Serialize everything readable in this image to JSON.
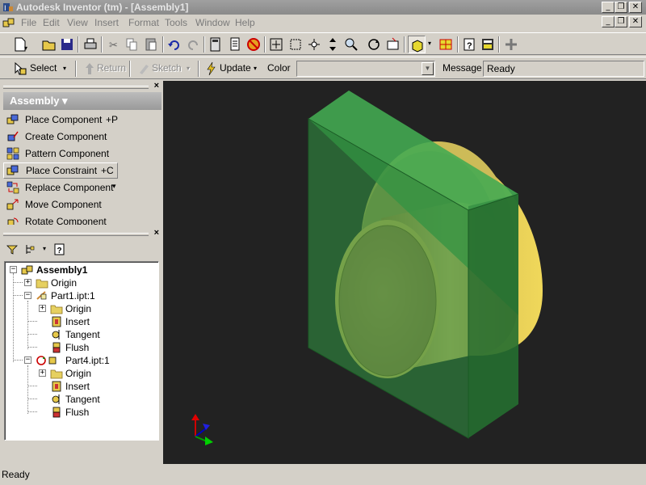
{
  "window": {
    "title": "Autodesk Inventor (tm) - [Assembly1]",
    "controls": [
      "_",
      "❐",
      "✕"
    ],
    "doc_controls": [
      "_",
      "❐",
      "✕"
    ]
  },
  "menu": [
    "File",
    "Edit",
    "View",
    "Insert",
    "Format",
    "Tools",
    "Window",
    "Help"
  ],
  "toolbar2": {
    "select": "Select",
    "return": "Return",
    "sketch": "Sketch",
    "update": "Update",
    "color_label": "Color",
    "color_value": "",
    "message_label": "Message",
    "message_value": "Ready"
  },
  "panel": {
    "header": "Assembly ▾",
    "commands": [
      {
        "label": "Place Component",
        "shortcut": "+P"
      },
      {
        "label": "Create Component",
        "shortcut": ""
      },
      {
        "label": "Pattern Component",
        "shortcut": ""
      },
      {
        "label": "Place Constraint",
        "shortcut": "+C"
      },
      {
        "label": "Replace Component",
        "shortcut": "▾"
      },
      {
        "label": "Move Component",
        "shortcut": ""
      },
      {
        "label": "Rotate Component",
        "shortcut": ""
      }
    ]
  },
  "tree": {
    "root": "Assembly1",
    "origin": "Origin",
    "part1": "Part1.ipt:1",
    "part4": "Part4.ipt:1",
    "child_origin": "Origin",
    "insert": "Insert",
    "tangent": "Tangent",
    "flush": "Flush"
  },
  "status": "Ready",
  "colors": {
    "viewport_bg": "#222222",
    "plate": "#2f8a3f",
    "cylinder": "#c8a850",
    "title_bar": "#8a8a8a"
  }
}
